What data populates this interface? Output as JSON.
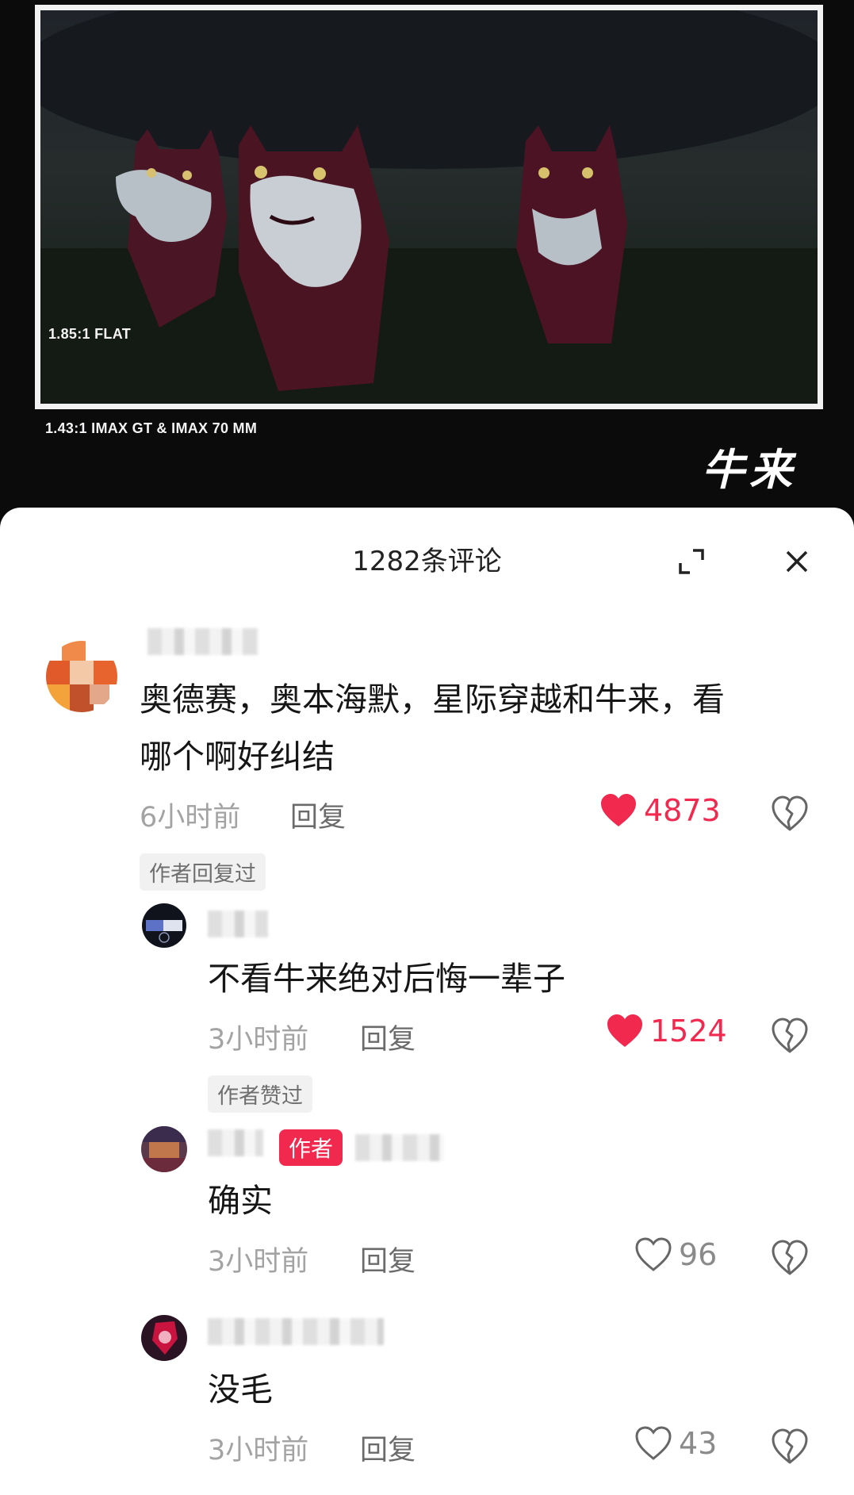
{
  "video": {
    "caption_inner": "1.85:1 FLAT",
    "caption_outer": "1.43:1 IMAX GT & IMAX 70 MM",
    "watermark": "牛来"
  },
  "comments_header": {
    "title": "1282条评论"
  },
  "comments": [
    {
      "text_line1": "奥德赛，奥本海默，星际穿越和牛来，看",
      "text_line2": "哪个啊好纠结",
      "time": "6小时前",
      "reply": "回复",
      "likes": "4873",
      "liked": true,
      "tag": "作者回复过"
    }
  ],
  "replies": [
    {
      "text": "不看牛来绝对后悔一辈子",
      "time": "3小时前",
      "reply": "回复",
      "likes": "1524",
      "liked": true,
      "tag": "作者赞过"
    },
    {
      "badge": "作者",
      "text": "确实",
      "time": "3小时前",
      "reply": "回复",
      "likes": "96",
      "liked": false
    },
    {
      "text": "没毛",
      "time": "3小时前",
      "reply": "回复",
      "likes": "43",
      "liked": false
    }
  ],
  "colors": {
    "like_red": "#f2294f",
    "badge_red": "#f2294f",
    "meta_gray": "#a3a3a3"
  },
  "icons": [
    "expand-icon",
    "close-icon",
    "heart-icon",
    "broken-heart-icon"
  ]
}
